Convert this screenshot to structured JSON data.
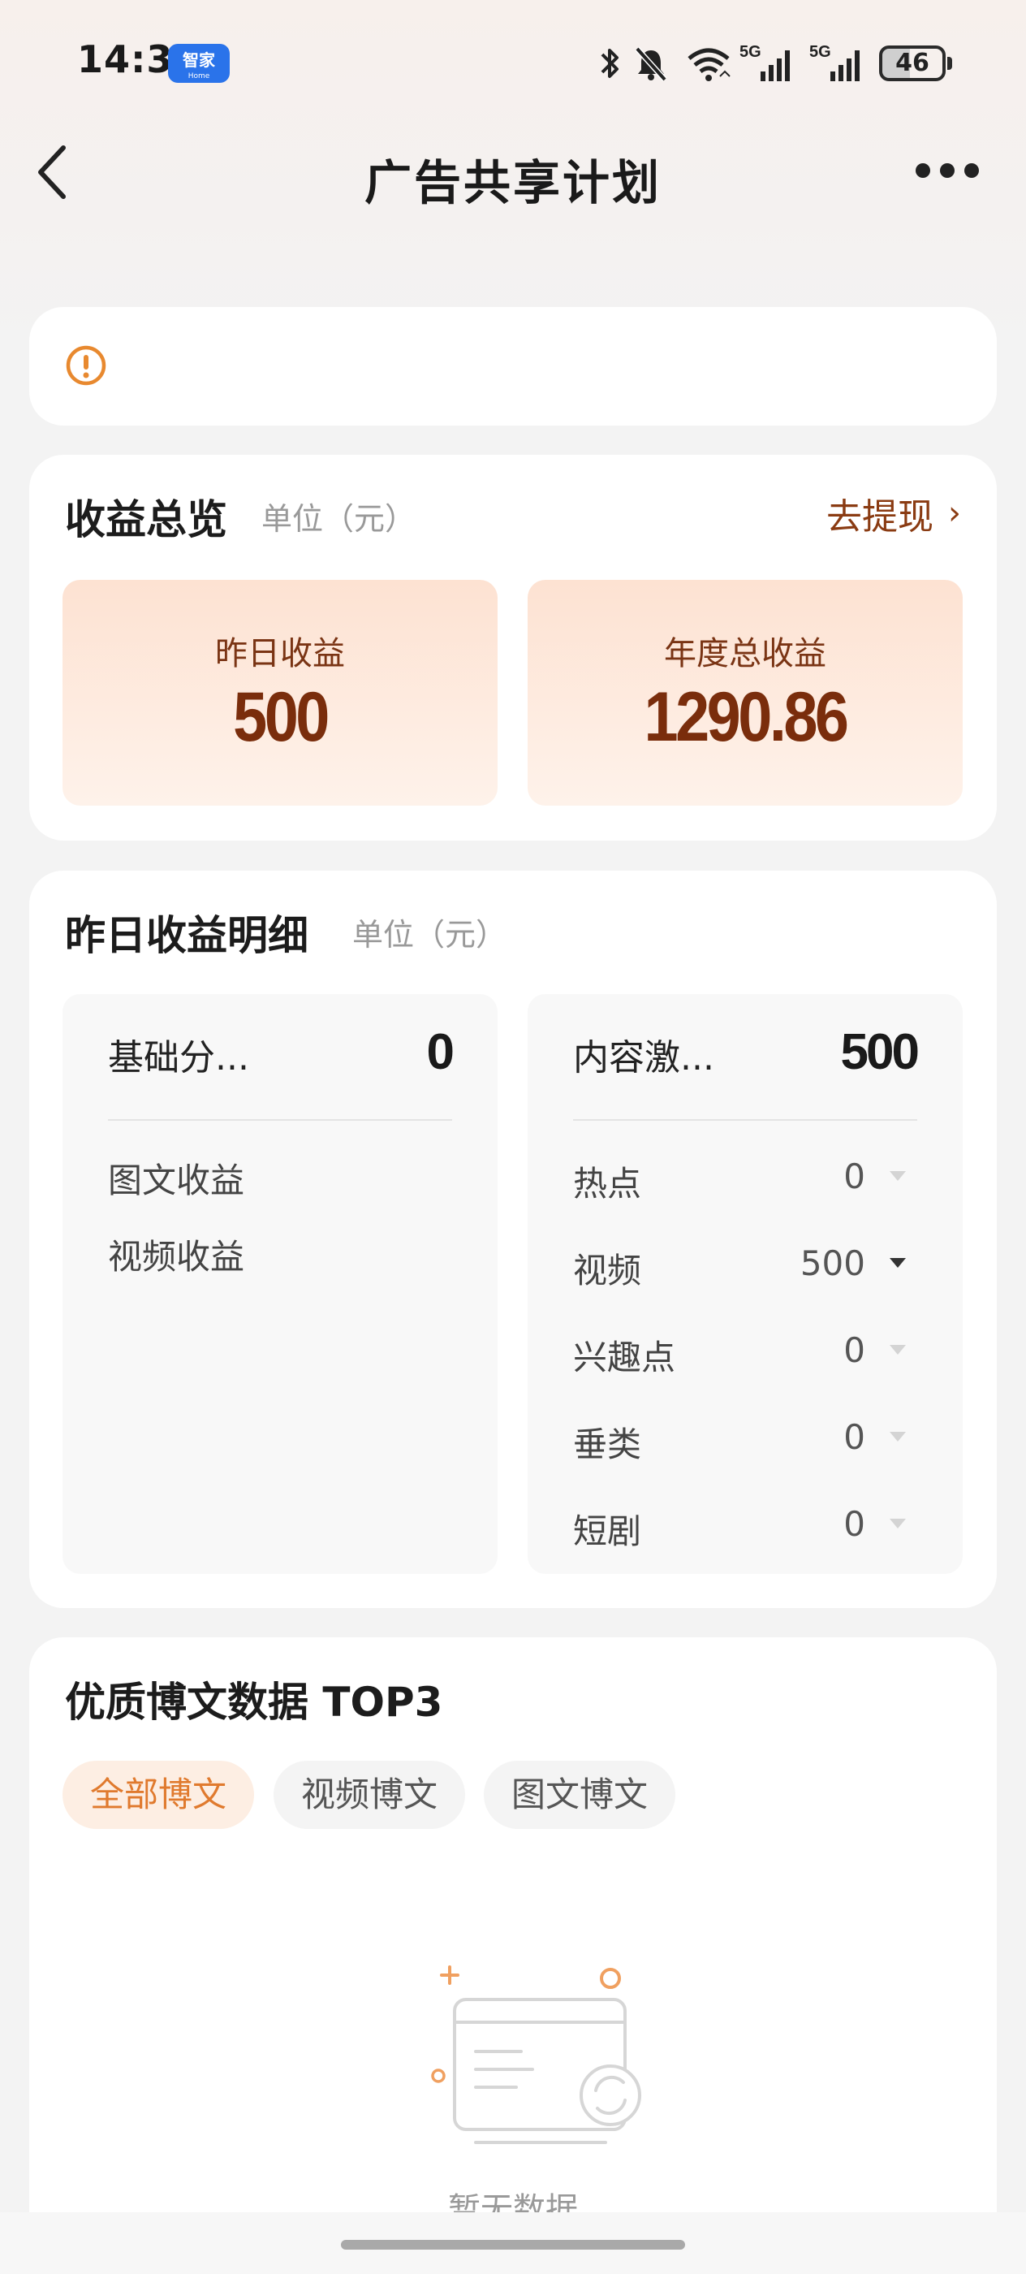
{
  "status_bar": {
    "time": "14:35",
    "app_badge": "智家",
    "app_badge_sub": "Home",
    "battery": "46",
    "network1": "5G",
    "network2": "5G"
  },
  "nav": {
    "title": "广告共享计划"
  },
  "overview": {
    "title": "收益总览",
    "unit": "单位（元）",
    "withdraw": "去提现",
    "yesterday_label": "昨日收益",
    "yesterday_value": "500",
    "annual_label": "年度总收益",
    "annual_value": "1290.86"
  },
  "detail": {
    "title": "昨日收益明细",
    "unit": "单位（元）",
    "base": {
      "label": "基础分...",
      "value": "0",
      "items": [
        "图文收益",
        "视频收益"
      ]
    },
    "content": {
      "label": "内容激...",
      "value": "500",
      "rows": [
        {
          "name": "热点",
          "value": "0"
        },
        {
          "name": "视频",
          "value": "500"
        },
        {
          "name": "兴趣点",
          "value": "0"
        },
        {
          "name": "垂类",
          "value": "0"
        },
        {
          "name": "短剧",
          "value": "0"
        }
      ]
    }
  },
  "top3": {
    "title": "优质博文数据 TOP3",
    "tabs": [
      "全部博文",
      "视频博文",
      "图文博文"
    ],
    "empty_text": "暂无数据"
  },
  "colors": {
    "accent": "#e07a2e",
    "brown": "#7a2d0c",
    "warning": "#e8892f"
  }
}
